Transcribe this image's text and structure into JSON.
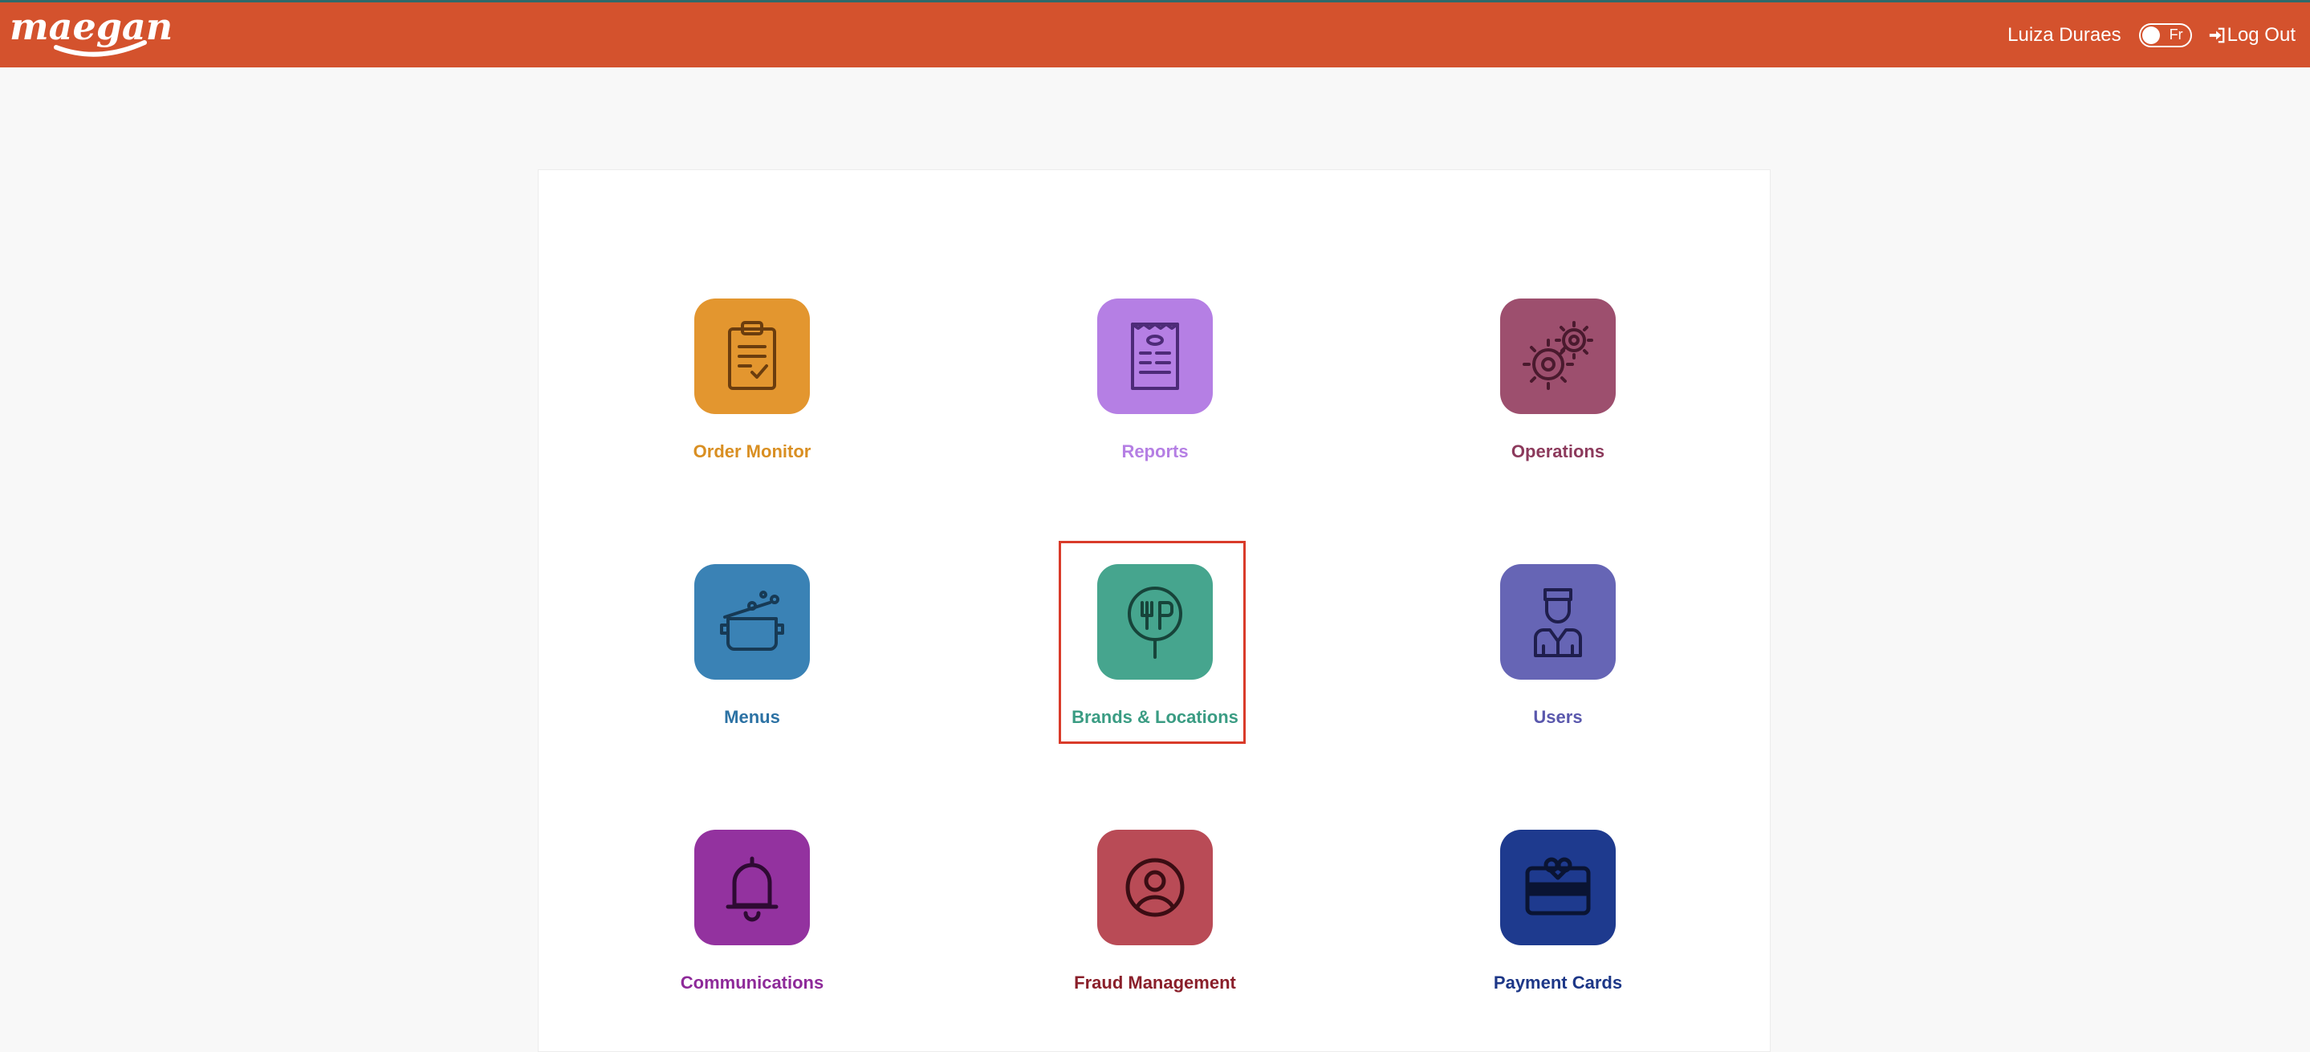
{
  "header": {
    "brand": "maegan",
    "user_name": "Luiza Duraes",
    "language_toggle_label": "Fr",
    "logout_label": "Log Out",
    "bar_color": "#d4522d"
  },
  "tiles": [
    {
      "label": "Order Monitor",
      "icon": "clipboard-check-icon",
      "bg": "#e3962f",
      "color": "#d98f22"
    },
    {
      "label": "Reports",
      "icon": "receipt-icon",
      "bg": "#b57fe4",
      "color": "#b57fe4"
    },
    {
      "label": "Operations",
      "icon": "gears-icon",
      "bg": "#9d4f6e",
      "color": "#8c3a5c"
    },
    {
      "label": "Menus",
      "icon": "cooking-pot-icon",
      "bg": "#3a82b5",
      "color": "#2c72a4"
    },
    {
      "label": "Brands & Locations",
      "icon": "restaurant-pin-icon",
      "bg": "#46a58e",
      "color": "#3a9c83",
      "selected": true
    },
    {
      "label": "Users",
      "icon": "chef-icon",
      "bg": "#6665b5",
      "color": "#5a58ad"
    },
    {
      "label": "Communications",
      "icon": "bell-icon",
      "bg": "#93329f",
      "color": "#8e2a99"
    },
    {
      "label": "Fraud Management",
      "icon": "user-circle-icon",
      "bg": "#b94b56",
      "color": "#8a1f2a"
    },
    {
      "label": "Payment Cards",
      "icon": "gift-card-icon",
      "bg": "#1e3a8e",
      "color": "#1d3787"
    }
  ]
}
